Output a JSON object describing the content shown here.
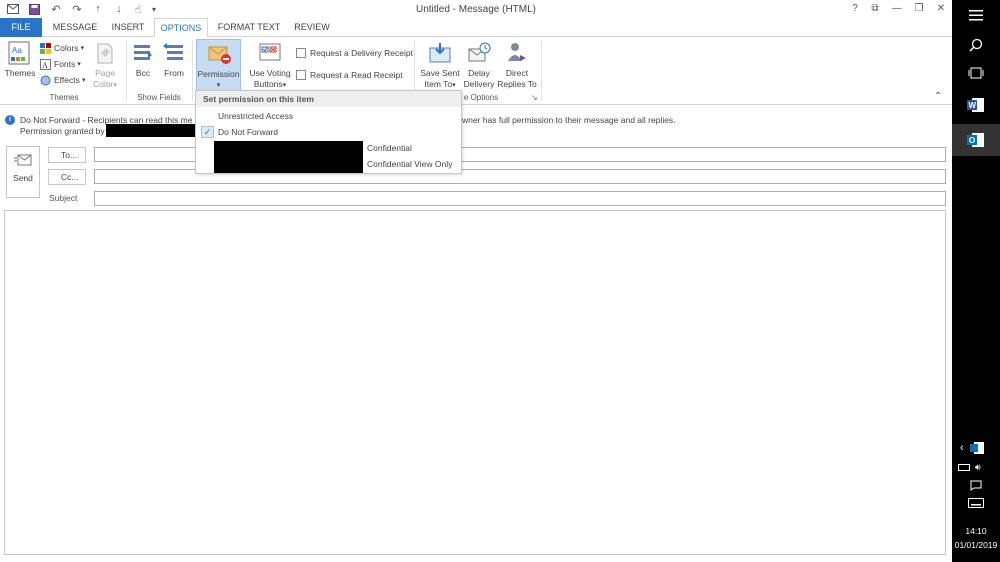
{
  "window": {
    "title": "Untitled - Message (HTML)",
    "controls": [
      "?",
      "⧉",
      "—",
      "❐",
      "✕"
    ]
  },
  "tabs": [
    {
      "label": "FILE"
    },
    {
      "label": "MESSAGE"
    },
    {
      "label": "INSERT"
    },
    {
      "label": "OPTIONS"
    },
    {
      "label": "FORMAT TEXT"
    },
    {
      "label": "REVIEW"
    }
  ],
  "ribbon": {
    "themes": {
      "themes_line1": "Themes",
      "colors": "Colors",
      "fonts": "Fonts",
      "effects": "Effects",
      "page_color_line1": "Page",
      "page_color_line2": "Color",
      "group_label": "Themes"
    },
    "show_fields": {
      "bcc": "Bcc",
      "from": "From",
      "group_label": "Show Fields"
    },
    "permission": {
      "label": "Permission"
    },
    "tracking": {
      "voting_line1": "Use Voting",
      "voting_line2": "Buttons",
      "delivery_receipt": "Request a Delivery Receipt",
      "read_receipt": "Request a Read Receipt"
    },
    "more_options": {
      "save_sent_line1": "Save Sent",
      "save_sent_line2": "Item To",
      "delay_line1": "Delay",
      "delay_line2": "Delivery",
      "direct_line1": "Direct",
      "direct_line2": "Replies To",
      "group_label_visible": "e Options"
    }
  },
  "infobar": {
    "line1_start": "Do Not Forward - Recipients can read this me",
    "line1_end": "wner has full permission to their message and all replies.",
    "line2": "Permission granted by"
  },
  "compose": {
    "send": "Send",
    "to": "To...",
    "cc": "Cc...",
    "subject": "Subject"
  },
  "dropdown": {
    "header": "Set permission on this item",
    "items": [
      {
        "label": "Unrestricted Access",
        "checked": false
      },
      {
        "label": "Do Not Forward",
        "checked": true
      },
      {
        "label": "Confidential",
        "checked": false
      },
      {
        "label": "Confidential View Only",
        "checked": false
      }
    ]
  },
  "taskbar": {
    "time": "14:10",
    "date": "01/01/2019"
  },
  "colors": {
    "accent": "#2b73c7",
    "outlook": "#0072c6",
    "word": "#2b579a"
  }
}
